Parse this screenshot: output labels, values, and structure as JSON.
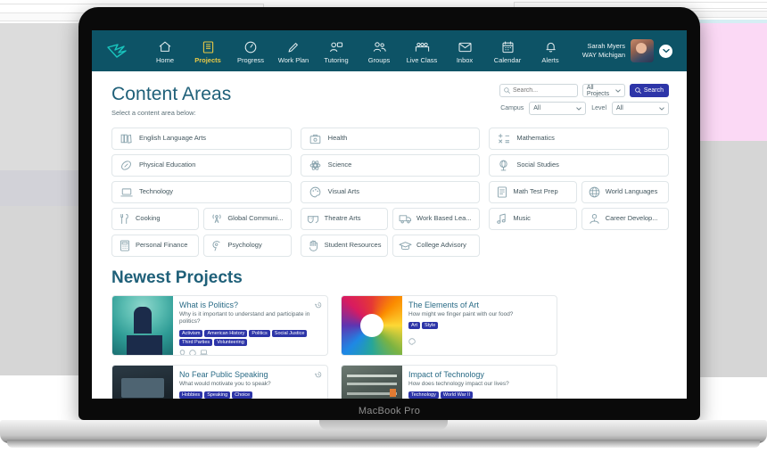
{
  "device": {
    "label": "MacBook Pro"
  },
  "header": {
    "logo_icon": "bird-logo-icon",
    "nav": [
      {
        "label": "Home",
        "icon": "home-icon",
        "active": false
      },
      {
        "label": "Projects",
        "icon": "book-icon",
        "active": true
      },
      {
        "label": "Progress",
        "icon": "gauge-icon",
        "active": false
      },
      {
        "label": "Work Plan",
        "icon": "pencil-icon",
        "active": false
      },
      {
        "label": "Tutoring",
        "icon": "tutor-icon",
        "active": false
      },
      {
        "label": "Groups",
        "icon": "groups-icon",
        "active": false
      },
      {
        "label": "Live Class",
        "icon": "liveclass-icon",
        "active": false
      },
      {
        "label": "Inbox",
        "icon": "envelope-icon",
        "active": false
      },
      {
        "label": "Calendar",
        "icon": "calendar-icon",
        "active": false
      },
      {
        "label": "Alerts",
        "icon": "bell-icon",
        "active": false
      }
    ],
    "user": {
      "name": "Sarah Myers",
      "org": "WAY Michigan",
      "avatar_icon": "avatar",
      "caret_icon": "chevron-down-icon"
    },
    "bar_color": "#0d5366",
    "active_color": "#e8c847"
  },
  "content_areas": {
    "title": "Content Areas",
    "subtitle": "Select a content area below:",
    "columns": [
      {
        "full": [
          {
            "label": "English Language Arts",
            "icon": "books-icon"
          },
          {
            "label": "Physical Education",
            "icon": "football-icon"
          },
          {
            "label": "Technology",
            "icon": "laptop-icon"
          }
        ],
        "pairs": [
          [
            {
              "label": "Cooking",
              "icon": "utensils-icon"
            },
            {
              "label": "Global Communi...",
              "icon": "broadcast-icon"
            }
          ],
          [
            {
              "label": "Personal Finance",
              "icon": "calculator-icon"
            },
            {
              "label": "Psychology",
              "icon": "brain-icon"
            }
          ]
        ]
      },
      {
        "full": [
          {
            "label": "Health",
            "icon": "medkit-icon"
          },
          {
            "label": "Science",
            "icon": "atom-icon"
          },
          {
            "label": "Visual Arts",
            "icon": "palette-icon"
          }
        ],
        "pairs": [
          [
            {
              "label": "Theatre Arts",
              "icon": "masks-icon"
            },
            {
              "label": "Work Based Lea...",
              "icon": "truck-icon"
            }
          ],
          [
            {
              "label": "Student Resources",
              "icon": "hand-icon"
            },
            {
              "label": "College Advisory",
              "icon": "graduation-cap-icon"
            }
          ]
        ]
      },
      {
        "full": [
          {
            "label": "Mathematics",
            "icon": "math-icon"
          },
          {
            "label": "Social Studies",
            "icon": "globe-stand-icon"
          }
        ],
        "pairs": [
          [
            {
              "label": "Math Test Prep",
              "icon": "document-icon"
            },
            {
              "label": "World Languages",
              "icon": "globe-icon"
            }
          ],
          [
            {
              "label": "Music",
              "icon": "music-note-icon"
            },
            {
              "label": "Career Develop...",
              "icon": "person-tie-icon"
            }
          ]
        ]
      }
    ]
  },
  "search": {
    "placeholder": "Search...",
    "value": "",
    "search_icon": "search-icon",
    "scope_value": "All Projects",
    "scope_caret_icon": "chevron-down-icon",
    "button_label": "Search",
    "button_color": "#2d35a8",
    "campus_label": "Campus",
    "campus_value": "All",
    "level_label": "Level",
    "level_value": "All"
  },
  "newest_projects": {
    "title": "Newest Projects",
    "cards": [
      {
        "title": "What is Politics?",
        "desc": "Why is it important to understand and participate in politics?",
        "tags": [
          "Activism",
          "American History",
          "Politics",
          "Social Justice",
          "Third Parties",
          "Volunteering"
        ],
        "thumb": "thumb-politics",
        "history_icon": "history-icon",
        "footer_icons": [
          "lightbulb-icon",
          "palette-icon",
          "laptop-icon"
        ]
      },
      {
        "title": "The Elements of Art",
        "desc": "How might we finger paint with our food?",
        "tags": [
          "Art",
          "Style"
        ],
        "thumb": "thumb-art",
        "history_icon": "",
        "footer_icons": [
          "palette-icon"
        ]
      },
      {
        "title": "No Fear Public Speaking",
        "desc": "What would motivate you to speak?",
        "tags": [
          "Hobbies",
          "Speaking",
          "Choice"
        ],
        "thumb": "thumb-speaking",
        "history_icon": "history-icon",
        "footer_icons": []
      },
      {
        "title": "Impact of Technology",
        "desc": "How does technology impact our lives?",
        "tags": [
          "Technology",
          "World War II"
        ],
        "thumb": "thumb-tech",
        "history_icon": "",
        "footer_icons": []
      }
    ]
  }
}
